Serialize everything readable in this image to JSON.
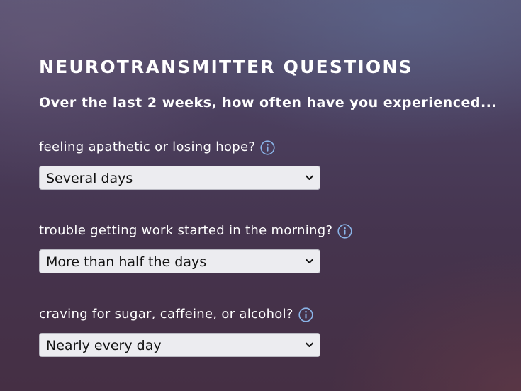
{
  "page": {
    "title": "NEUROTRANSMITTER QUESTIONS",
    "intro": "Over the last 2 weeks, how often have you experienced..."
  },
  "questions": [
    {
      "label": "feeling apathetic or losing hope?",
      "info_icon": "info-circle-icon",
      "selected": "Several days"
    },
    {
      "label": "trouble getting work started in the morning?",
      "info_icon": "info-circle-icon",
      "selected": "More than half the days"
    },
    {
      "label": "craving for sugar, caffeine, or alcohol?",
      "info_icon": "info-circle-icon",
      "selected": "Nearly every day"
    }
  ],
  "colors": {
    "info_icon": "#8ab4e8",
    "select_background": "#ececf0",
    "text": "#ffffff"
  }
}
